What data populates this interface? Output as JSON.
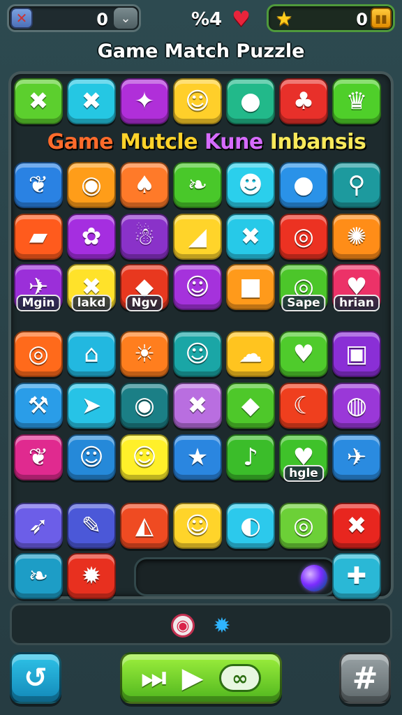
{
  "hud": {
    "left_counter": "0",
    "right_counter": "0",
    "center_status": "%4",
    "icons": {
      "left": "crossed-tools-icon",
      "left_toggle": "chevron-down-icon",
      "center": "heart-icon",
      "right": "star-icon",
      "right_end": "coin-icon"
    }
  },
  "title": "Game Match Puzzle",
  "banner": {
    "w1": "Game",
    "w2": "Mutcle",
    "w3": "Kune",
    "w4": "Inbansis"
  },
  "tiles": [
    {
      "row": 0,
      "col": 0,
      "color": "#5ccf2e",
      "glyph": "✖",
      "icon": "cross-swords-icon"
    },
    {
      "row": 0,
      "col": 1,
      "color": "#25c7e3",
      "glyph": "✖",
      "icon": "crossed-blades-icon"
    },
    {
      "row": 0,
      "col": 2,
      "color": "#b02fd9",
      "glyph": "✦",
      "icon": "spinning-top-icon"
    },
    {
      "row": 0,
      "col": 3,
      "color": "#ffcf2a",
      "glyph": "☺",
      "icon": "bear-face-icon"
    },
    {
      "row": 0,
      "col": 4,
      "color": "#22b98a",
      "glyph": "●",
      "icon": "green-fruit-icon"
    },
    {
      "row": 0,
      "col": 5,
      "color": "#e8302a",
      "glyph": "♣",
      "icon": "torch-icon"
    },
    {
      "row": 0,
      "col": 6,
      "color": "#4fcf2a",
      "glyph": "♛",
      "icon": "crown-icon"
    },
    {
      "row": 2,
      "col": 0,
      "color": "#2a82e3",
      "glyph": "❦",
      "icon": "leaf-icon"
    },
    {
      "row": 2,
      "col": 1,
      "color": "#ff9d19",
      "glyph": "◉",
      "icon": "hive-icon"
    },
    {
      "row": 2,
      "col": 2,
      "color": "#ff7a29",
      "glyph": "♠",
      "icon": "bell-icon"
    },
    {
      "row": 2,
      "col": 3,
      "color": "#49c82a",
      "glyph": "❧",
      "icon": "feather-icon"
    },
    {
      "row": 2,
      "col": 4,
      "color": "#2bcfec",
      "glyph": "☻",
      "icon": "bird-icon"
    },
    {
      "row": 2,
      "col": 5,
      "color": "#2a92e8",
      "glyph": "●",
      "icon": "blue-bomb-icon"
    },
    {
      "row": 2,
      "col": 6,
      "color": "#1d9a9e",
      "glyph": "⚲",
      "icon": "brush-icon"
    },
    {
      "row": 3,
      "col": 0,
      "color": "#ff5b1d",
      "glyph": "▰",
      "icon": "bandage-icon"
    },
    {
      "row": 3,
      "col": 1,
      "color": "#a52ee0",
      "glyph": "✿",
      "icon": "puzzle-piece-icon"
    },
    {
      "row": 3,
      "col": 2,
      "color": "#8a32c9",
      "glyph": "☃",
      "icon": "snow-creature-icon"
    },
    {
      "row": 3,
      "col": 3,
      "color": "#ffd42a",
      "glyph": "◢",
      "icon": "blue-wedge-icon"
    },
    {
      "row": 3,
      "col": 4,
      "color": "#27c9e8",
      "glyph": "✖",
      "icon": "crossed-arrows-icon"
    },
    {
      "row": 3,
      "col": 5,
      "color": "#ec3222",
      "glyph": "◎",
      "icon": "paperclip-icon"
    },
    {
      "row": 3,
      "col": 6,
      "color": "#ff8d18",
      "glyph": "✺",
      "icon": "orange-shell-icon"
    },
    {
      "row": 4,
      "col": 0,
      "color": "#9b2fd9",
      "glyph": "✈",
      "icon": "jet-icon",
      "label": "Mgin"
    },
    {
      "row": 4,
      "col": 1,
      "color": "#ffe22a",
      "glyph": "✖",
      "icon": "white-x-icon",
      "label": "lakd"
    },
    {
      "row": 4,
      "col": 2,
      "color": "#e8381f",
      "glyph": "◆",
      "icon": "blue-droplet-icon",
      "label": "Ngv"
    },
    {
      "row": 4,
      "col": 3,
      "color": "#a532dc",
      "glyph": "☺",
      "icon": "yellow-blob-icon"
    },
    {
      "row": 4,
      "col": 4,
      "color": "#ff9a1b",
      "glyph": "■",
      "icon": "red-box-icon"
    },
    {
      "row": 4,
      "col": 5,
      "color": "#4cc62a",
      "glyph": "◎",
      "icon": "donut-icon",
      "label": "Sape"
    },
    {
      "row": 4,
      "col": 6,
      "color": "#ec3268",
      "glyph": "♥",
      "icon": "heart-tile-icon",
      "label": "hrian"
    },
    {
      "row": 5,
      "col": 0,
      "color": "#ff6a1b",
      "glyph": "◎",
      "icon": "target-icon"
    },
    {
      "row": 5,
      "col": 1,
      "color": "#22b8e0",
      "glyph": "⌂",
      "icon": "house-icon"
    },
    {
      "row": 5,
      "col": 2,
      "color": "#ff7e1e",
      "glyph": "☀",
      "icon": "sun-face-icon"
    },
    {
      "row": 5,
      "col": 3,
      "color": "#1aa6a6",
      "glyph": "☺",
      "icon": "owl-icon"
    },
    {
      "row": 5,
      "col": 4,
      "color": "#ffc41f",
      "glyph": "☁",
      "icon": "white-creature-icon"
    },
    {
      "row": 5,
      "col": 5,
      "color": "#4fcb2c",
      "glyph": "♥",
      "icon": "blue-heart-icon"
    },
    {
      "row": 5,
      "col": 6,
      "color": "#8a2fd6",
      "glyph": "▣",
      "icon": "glass-jar-icon"
    },
    {
      "row": 6,
      "col": 0,
      "color": "#2a9de8",
      "glyph": "⚒",
      "icon": "hammer-icon"
    },
    {
      "row": 6,
      "col": 1,
      "color": "#27c3e6",
      "glyph": "➤",
      "icon": "paper-plane-icon"
    },
    {
      "row": 6,
      "col": 2,
      "color": "#1b7f86",
      "glyph": "◉",
      "icon": "blue-orb-icon"
    },
    {
      "row": 6,
      "col": 3,
      "color": "#b96ee0",
      "glyph": "✖",
      "icon": "orange-x-icon"
    },
    {
      "row": 6,
      "col": 4,
      "color": "#4ec82a",
      "glyph": "◆",
      "icon": "purple-gem-icon"
    },
    {
      "row": 6,
      "col": 5,
      "color": "#ef3f1e",
      "glyph": "☾",
      "icon": "banana-icon"
    },
    {
      "row": 6,
      "col": 6,
      "color": "#9a38d8",
      "glyph": "◍",
      "icon": "drum-icon"
    },
    {
      "row": 7,
      "col": 0,
      "color": "#e02a8f",
      "glyph": "❦",
      "icon": "leaf-fan-icon"
    },
    {
      "row": 7,
      "col": 1,
      "color": "#2589d9",
      "glyph": "☺",
      "icon": "frog-icon"
    },
    {
      "row": 7,
      "col": 2,
      "color": "#fff02a",
      "glyph": "☺",
      "icon": "pink-bear-icon"
    },
    {
      "row": 7,
      "col": 3,
      "color": "#2a86e0",
      "glyph": "★",
      "icon": "star-tile-icon"
    },
    {
      "row": 7,
      "col": 4,
      "color": "#3bbd2a",
      "glyph": "♪",
      "icon": "torch-leaf-icon"
    },
    {
      "row": 7,
      "col": 5,
      "color": "#3fc22a",
      "glyph": "♥",
      "icon": "strawberry-icon",
      "label": "hgle"
    },
    {
      "row": 7,
      "col": 6,
      "color": "#2a8be0",
      "glyph": "✈",
      "icon": "rocket-icon"
    },
    {
      "row": 8,
      "col": 0,
      "color": "#6c5ee8",
      "glyph": "➶",
      "icon": "fish-icon"
    },
    {
      "row": 8,
      "col": 1,
      "color": "#4b58d8",
      "glyph": "✎",
      "icon": "pencil-icon"
    },
    {
      "row": 8,
      "col": 2,
      "color": "#ef4b22",
      "glyph": "◭",
      "icon": "rock-icon"
    },
    {
      "row": 8,
      "col": 3,
      "color": "#ffd42a",
      "glyph": "☺",
      "icon": "green-smile-icon"
    },
    {
      "row": 8,
      "col": 4,
      "color": "#2cc9ec",
      "glyph": "◐",
      "icon": "ball-icon"
    },
    {
      "row": 8,
      "col": 5,
      "color": "#6cd037",
      "glyph": "◎",
      "icon": "clock-icon"
    },
    {
      "row": 8,
      "col": 6,
      "color": "#e8261f",
      "glyph": "✖",
      "icon": "red-x-icon"
    },
    {
      "row": 9,
      "col": 0,
      "color": "#1d9dc6",
      "glyph": "❧",
      "icon": "carrot-icon"
    },
    {
      "row": 9,
      "col": 1,
      "color": "#e8301f",
      "glyph": "✹",
      "icon": "burst-icon"
    },
    {
      "row": 9,
      "col": 6,
      "color": "#2ab8d6",
      "glyph": "✚",
      "icon": "plus-icon"
    }
  ],
  "bottom": {
    "tray_icons": [
      "record-icon",
      "gear-icon"
    ],
    "buttons": {
      "undo": "undo-icon",
      "play": [
        "skip-icon",
        "play-icon",
        "infinity-icon"
      ],
      "grid": "grid-icon"
    }
  }
}
